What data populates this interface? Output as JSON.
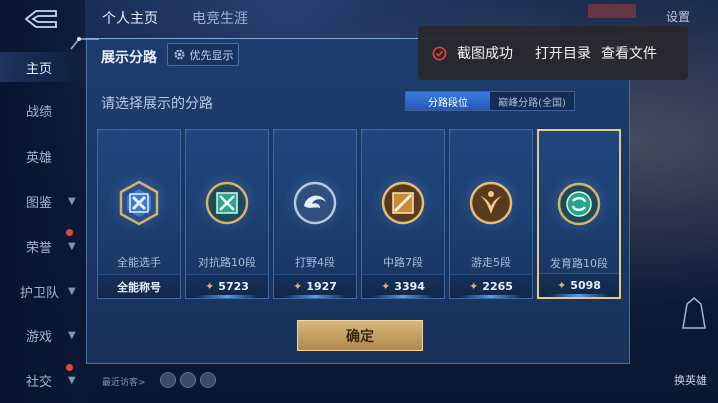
{
  "top_tabs": [
    {
      "label": "个人主页",
      "active": true
    },
    {
      "label": "电竞生涯",
      "active": false
    }
  ],
  "top_right": {
    "settings_label": "设置"
  },
  "left_nav": [
    {
      "label": "主页",
      "active": true,
      "has_chevron": false
    },
    {
      "label": "战绩",
      "active": false,
      "has_chevron": false
    },
    {
      "label": "英雄",
      "active": false,
      "has_chevron": false
    },
    {
      "label": "图鉴",
      "active": false,
      "has_chevron": true
    },
    {
      "label": "荣誉",
      "active": false,
      "has_chevron": true
    },
    {
      "label": "护卫队",
      "active": false,
      "has_chevron": true
    },
    {
      "label": "游戏",
      "active": false,
      "has_chevron": true
    },
    {
      "label": "社交",
      "active": false,
      "has_chevron": true
    }
  ],
  "dialog": {
    "title": "展示分路",
    "pref_label": "优先显示",
    "subtitle": "请选择展示的分路",
    "segments": {
      "active": "分路段位",
      "inactive": "巅峰分路(全国)"
    },
    "cards": [
      {
        "name": "全能选手",
        "score_label": "全能称号",
        "show_star": false,
        "selected": false,
        "badge_color": "#3b78d8"
      },
      {
        "name": "对抗路10段",
        "score_label": "5723",
        "show_star": true,
        "selected": false,
        "badge_color": "#27a489"
      },
      {
        "name": "打野4段",
        "score_label": "1927",
        "show_star": true,
        "selected": false,
        "badge_color": "#5d8fcf"
      },
      {
        "name": "中路7段",
        "score_label": "3394",
        "show_star": true,
        "selected": false,
        "badge_color": "#c98a3a"
      },
      {
        "name": "游走5段",
        "score_label": "2265",
        "show_star": true,
        "selected": false,
        "badge_color": "#c98a3a"
      },
      {
        "name": "发育路10段",
        "score_label": "5098",
        "show_star": true,
        "selected": true,
        "badge_color": "#27a489"
      }
    ],
    "confirm_label": "确定"
  },
  "toast": {
    "message": "截图成功",
    "open_folder": "打开目录",
    "view_file": "查看文件"
  },
  "bottom": {
    "recent_label": "最近访客>",
    "change_hero_label": "换英雄"
  },
  "colors": {
    "accent_gold": "#e6c98a",
    "segment_blue": "#2f6bd0",
    "toast_bg": "#28282c",
    "toast_ok": "#e0463a"
  }
}
